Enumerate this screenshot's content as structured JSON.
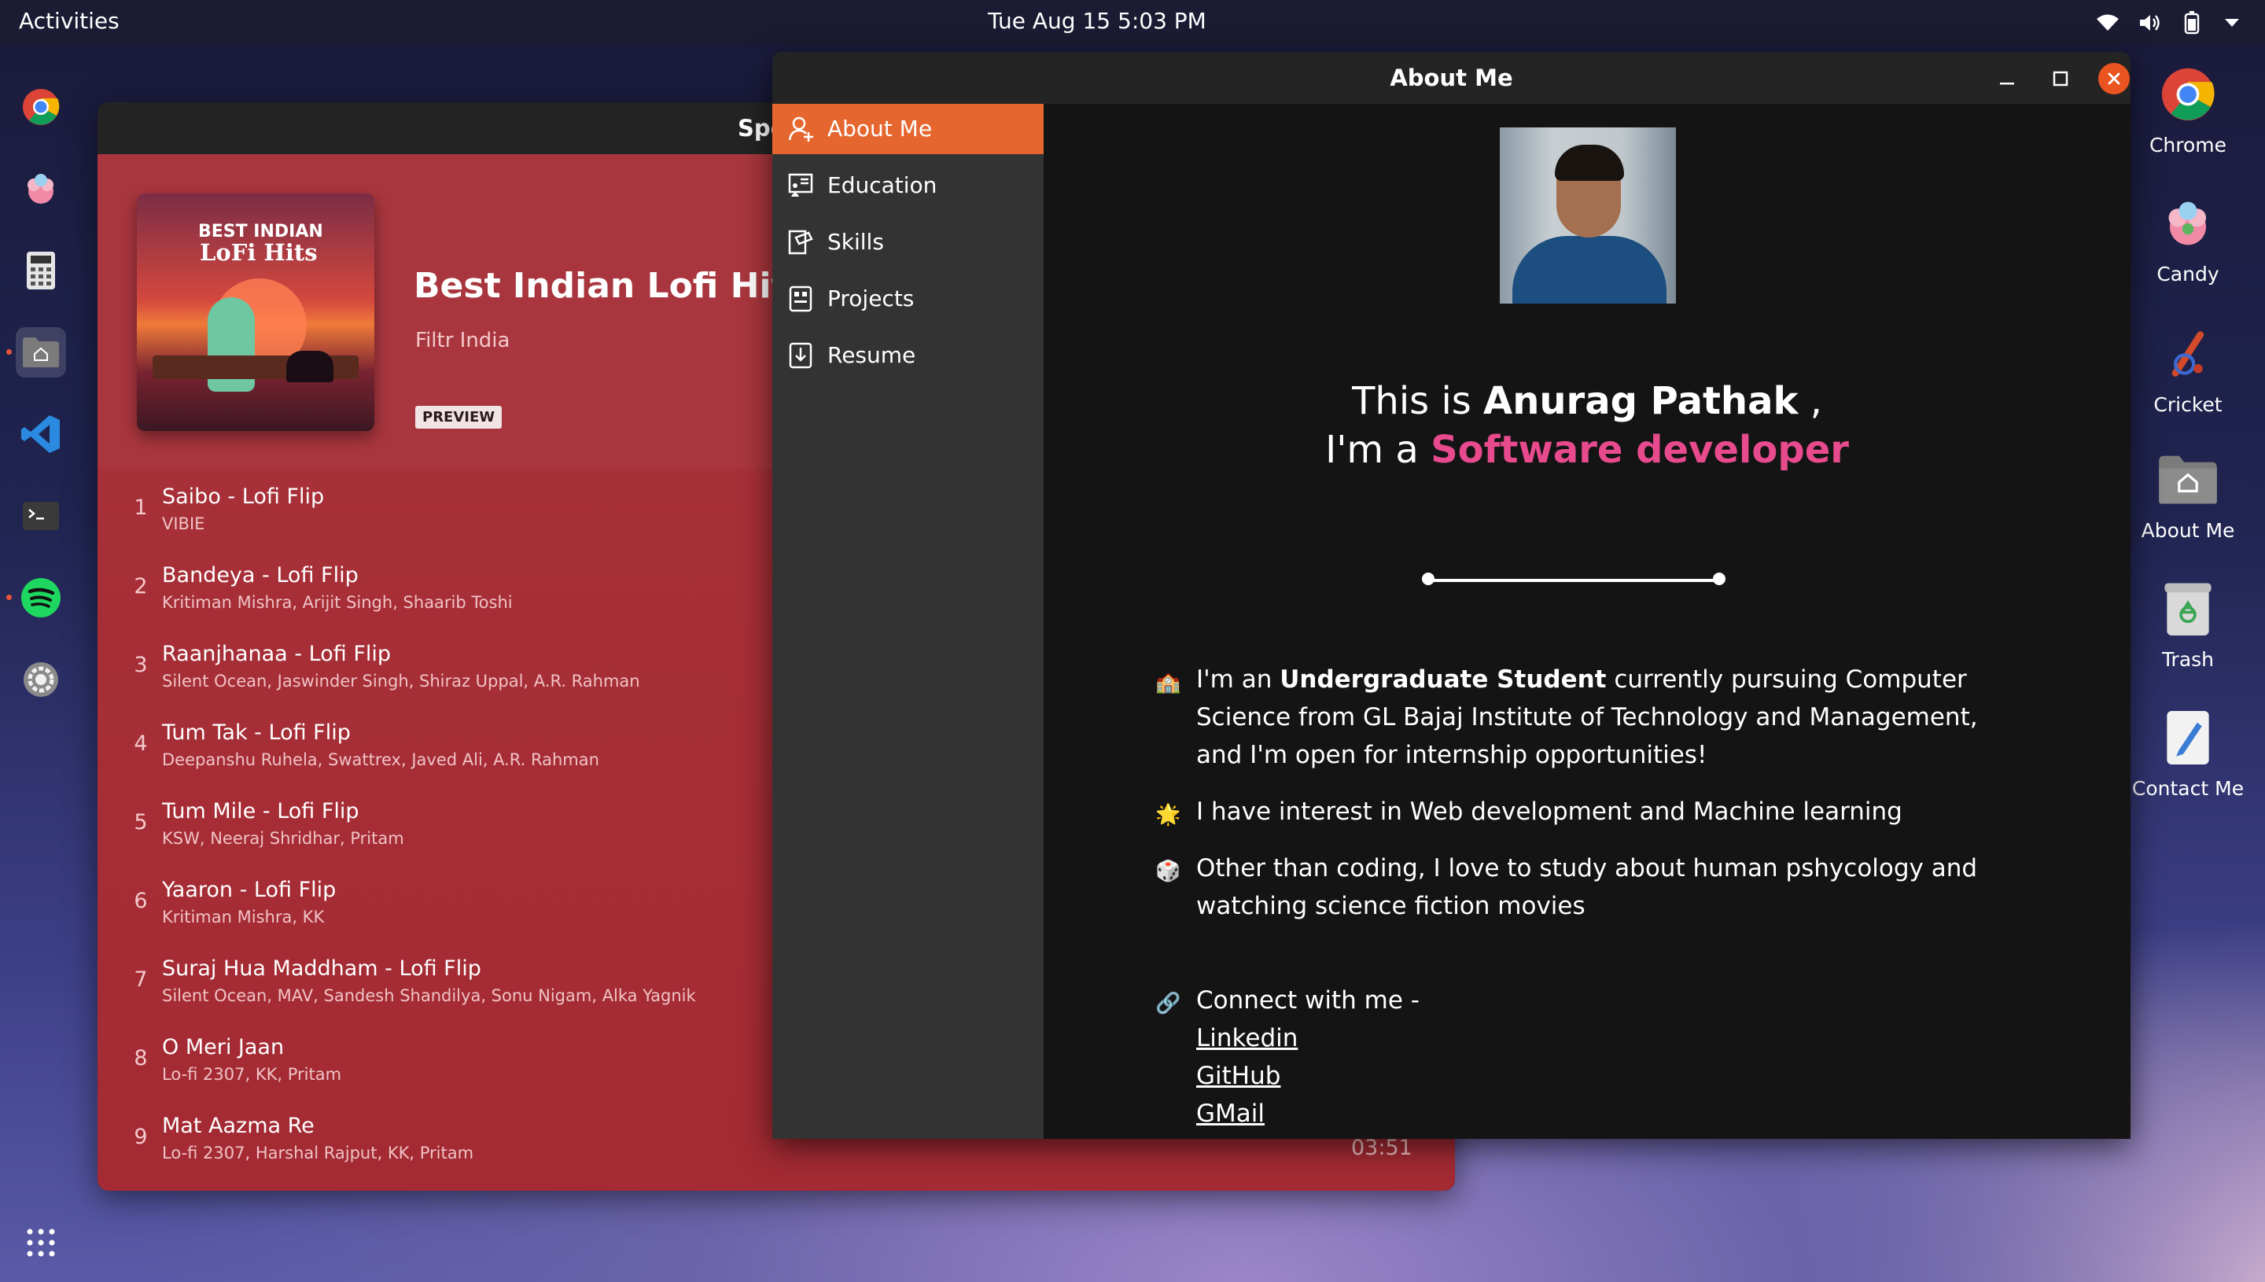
{
  "topbar": {
    "activities": "Activities",
    "clock": "Tue Aug 15  5:03 PM"
  },
  "dock": {
    "apps": [
      "chrome-icon",
      "candy-icon",
      "calculator-icon",
      "files-icon",
      "vscode-icon",
      "terminal-icon",
      "spotify-icon",
      "settings-icon"
    ],
    "show_apps": "grid-icon"
  },
  "desktop": {
    "icons": [
      {
        "label": "Chrome",
        "icon": "chrome-icon"
      },
      {
        "label": "Candy",
        "icon": "candy-icon"
      },
      {
        "label": "Cricket",
        "icon": "cricket-icon"
      },
      {
        "label": "About Me",
        "icon": "folder-home-icon"
      },
      {
        "label": "Trash",
        "icon": "trash-icon"
      },
      {
        "label": "Contact Me",
        "icon": "text-editor-icon"
      }
    ]
  },
  "spotify": {
    "window_title": "Spo",
    "playlist": {
      "cover_line1": "BEST INDIAN",
      "cover_line2": "LoFi Hits",
      "name": "Best Indian Lofi Hits",
      "owner": "Filtr India",
      "badge": "PREVIEW"
    },
    "tracks": [
      {
        "num": "1",
        "title": "Saibo - Lofi Flip",
        "artists": "VIBIE"
      },
      {
        "num": "2",
        "title": "Bandeya - Lofi Flip",
        "artists": "Kritiman Mishra, Arijit Singh, Shaarib Toshi"
      },
      {
        "num": "3",
        "title": "Raanjhanaa - Lofi Flip",
        "artists": "Silent Ocean, Jaswinder Singh, Shiraz Uppal, A.R. Rahman"
      },
      {
        "num": "4",
        "title": "Tum Tak - Lofi Flip",
        "artists": "Deepanshu Ruhela, Swattrex, Javed Ali, A.R. Rahman"
      },
      {
        "num": "5",
        "title": "Tum Mile - Lofi Flip",
        "artists": "KSW, Neeraj Shridhar, Pritam"
      },
      {
        "num": "6",
        "title": "Yaaron - Lofi Flip",
        "artists": "Kritiman Mishra, KK"
      },
      {
        "num": "7",
        "title": "Suraj Hua Maddham - Lofi Flip",
        "artists": "Silent Ocean, MAV, Sandesh Shandilya, Sonu Nigam, Alka Yagnik"
      },
      {
        "num": "8",
        "title": "O Meri Jaan",
        "artists": "Lo-fi 2307, KK, Pritam"
      },
      {
        "num": "9",
        "title": "Mat Aazma Re",
        "artists": "Lo-fi 2307, Harshal Rajput, KK, Pritam"
      }
    ],
    "visible_duration": "03:51"
  },
  "about": {
    "window_title": "About Me",
    "nav": [
      {
        "label": "About Me",
        "icon": "person-add-icon",
        "active": true
      },
      {
        "label": "Education",
        "icon": "classroom-icon",
        "active": false
      },
      {
        "label": "Skills",
        "icon": "skills-icon",
        "active": false
      },
      {
        "label": "Projects",
        "icon": "projects-icon",
        "active": false
      },
      {
        "label": "Resume",
        "icon": "download-icon",
        "active": false
      }
    ],
    "intro": {
      "line1_prefix": "This is ",
      "name": "Anurag Pathak",
      "line1_suffix": " ,",
      "line2_prefix": "I'm a ",
      "role": "Software developer"
    },
    "bullets": {
      "b1_emoji": "🏫",
      "b1_pre": "I'm an ",
      "b1_bold": "Undergraduate Student",
      "b1_post": " currently pursuing Computer Science from GL Bajaj Institute of Technology and Management, and I'm open for internship opportunities!",
      "b2_emoji": "🌟",
      "b2": "I have interest in Web development and Machine learning",
      "b3_emoji": "🎲",
      "b3": "Other than coding, I love to study about human pshycology and watching science fiction movies",
      "b4_emoji": "🔗",
      "b4": "Connect with me -",
      "links": [
        "Linkedin",
        "GitHub",
        "GMail"
      ]
    },
    "colors": {
      "accent": "#e5672f",
      "role": "#e84a8e",
      "close": "#e95420"
    }
  }
}
